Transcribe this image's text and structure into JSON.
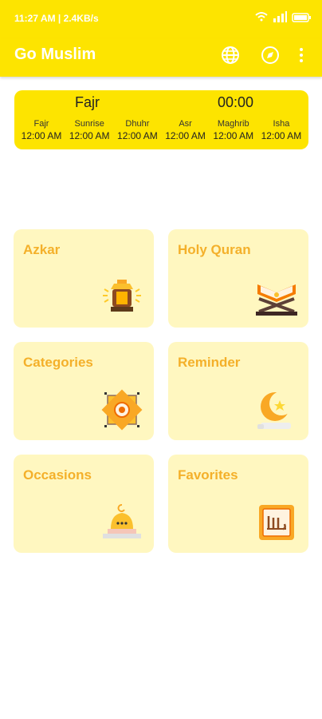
{
  "status_bar": {
    "text": "11:27 AM | 2.4KB/s",
    "battery": "100"
  },
  "appbar": {
    "title": "Go Muslim"
  },
  "prayer": {
    "current": "Fajr",
    "countdown": "00:00",
    "times": [
      {
        "name": "Fajr",
        "time": "12:00 AM"
      },
      {
        "name": "Sunrise",
        "time": "12:00 AM"
      },
      {
        "name": "Dhuhr",
        "time": "12:00 AM"
      },
      {
        "name": "Asr",
        "time": "12:00 AM"
      },
      {
        "name": "Maghrib",
        "time": "12:00 AM"
      },
      {
        "name": "Isha",
        "time": "12:00 AM"
      }
    ]
  },
  "tiles": [
    {
      "label": "Azkar",
      "icon": "lantern-icon"
    },
    {
      "label": "Holy Quran",
      "icon": "quran-icon"
    },
    {
      "label": "Categories",
      "icon": "pattern-icon"
    },
    {
      "label": "Reminder",
      "icon": "crescent-star-icon"
    },
    {
      "label": "Occasions",
      "icon": "mosque-icon"
    },
    {
      "label": "Favorites",
      "icon": "allah-calligraphy-icon"
    }
  ],
  "colors": {
    "brand_yellow": "#fde400",
    "tile_bg": "#fff7c0",
    "tile_label": "#f4b02a"
  }
}
